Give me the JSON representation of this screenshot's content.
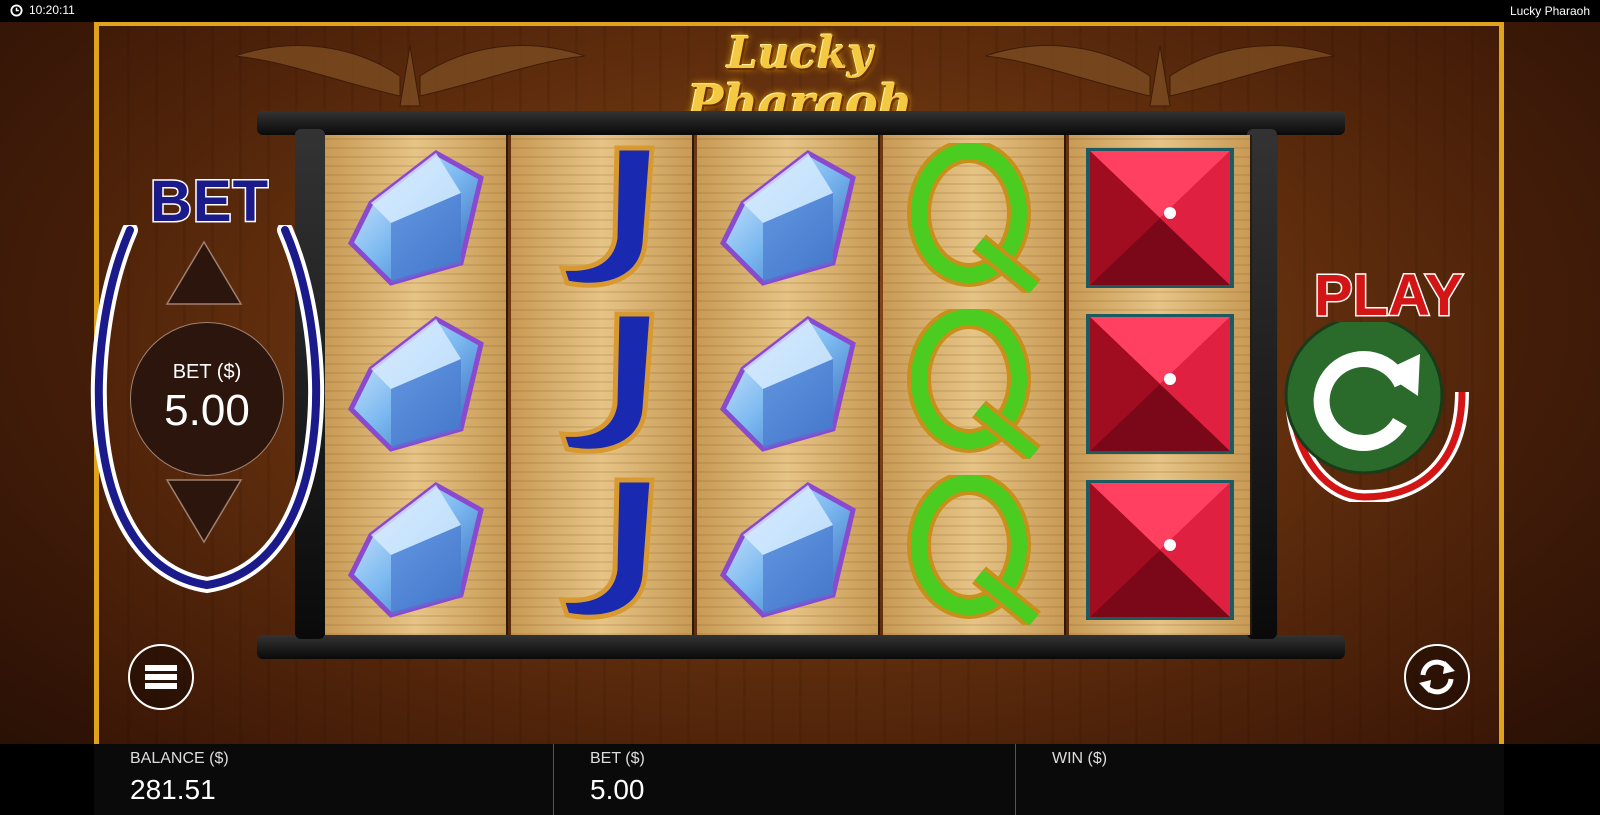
{
  "top_bar": {
    "time": "10:20:11",
    "window_title": "Lucky Pharaoh"
  },
  "logo": {
    "line1": "Lucky",
    "line2": "Pharaoh"
  },
  "bet_control": {
    "title": "BET",
    "label": "BET ($)",
    "value": "5.00",
    "up_icon": "triangle-up-icon",
    "down_icon": "triangle-down-icon"
  },
  "play_control": {
    "title": "PLAY",
    "icon": "replay-arrow-icon"
  },
  "menu_button": {
    "icon": "hamburger-menu-icon"
  },
  "autoplay_button": {
    "icon": "refresh-cycle-icon"
  },
  "reels": [
    [
      "blue-crystal",
      "blue-crystal",
      "blue-crystal"
    ],
    [
      "J",
      "J",
      "J"
    ],
    [
      "blue-crystal",
      "blue-crystal",
      "blue-crystal"
    ],
    [
      "Q",
      "Q",
      "Q"
    ],
    [
      "red-gem",
      "red-gem",
      "red-gem"
    ]
  ],
  "bottom_bar": {
    "balance_label": "BALANCE ($)",
    "balance_value": "281.51",
    "bet_label": "BET ($)",
    "bet_value": "5.00",
    "win_label": "WIN ($)",
    "win_value": ""
  },
  "colors": {
    "gold_frame": "#e0a41c",
    "bet_blue": "#1a1a8a",
    "play_red": "#d41515",
    "play_green": "#2a6a2a"
  }
}
